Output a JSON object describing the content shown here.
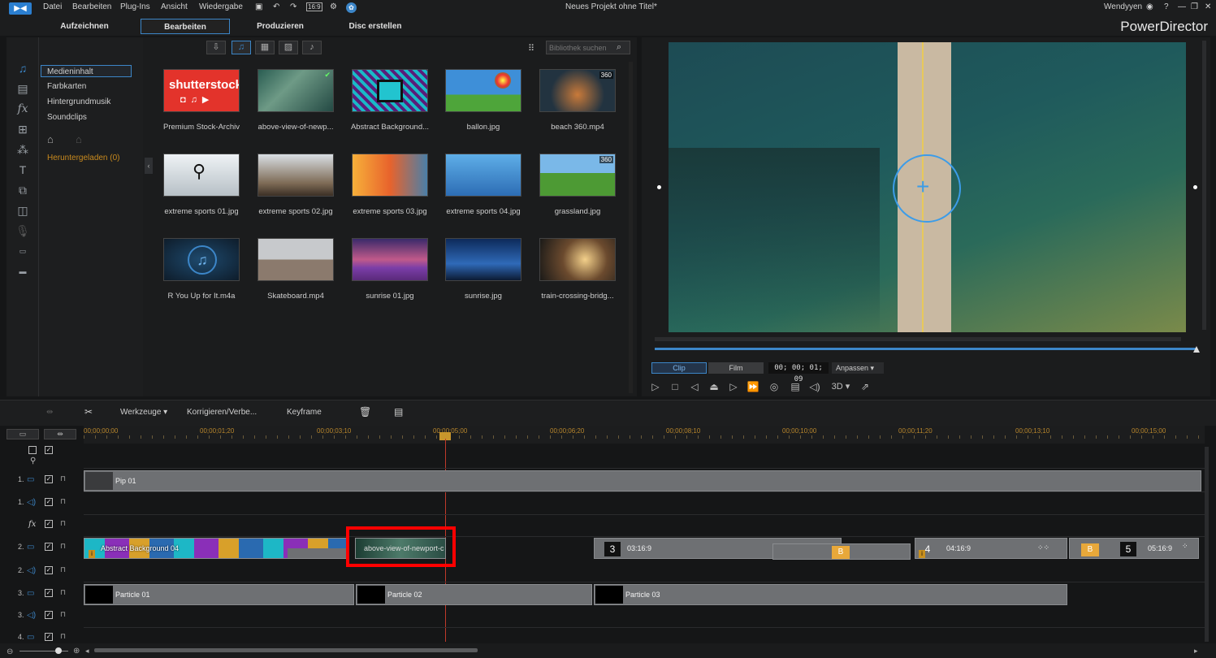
{
  "menu": {
    "items": [
      "Datei",
      "Bearbeiten",
      "Plug-Ins",
      "Ansicht",
      "Wiedergabe"
    ],
    "title": "Neues Projekt ohne Titel*",
    "user": "Wendyyen",
    "help": "?"
  },
  "tabs": [
    "Aufzeichnen",
    "Bearbeiten",
    "Produzieren",
    "Disc erstellen"
  ],
  "brand": "PowerDirector",
  "categories": [
    "Medieninhalt",
    "Farbkarten",
    "Hintergrundmusik",
    "Soundclips"
  ],
  "downloaded": "Heruntergeladen  (0)",
  "search": {
    "placeholder": "Bibliothek suchen"
  },
  "media": [
    {
      "label": "Premium Stock-Archiv",
      "logo": "shutterstock"
    },
    {
      "label": "above-view-of-newp..."
    },
    {
      "label": "Abstract Background..."
    },
    {
      "label": "ballon.jpg"
    },
    {
      "label": "beach 360.mp4",
      "badge": "360"
    },
    {
      "label": "extreme sports 01.jpg"
    },
    {
      "label": "extreme sports 02.jpg"
    },
    {
      "label": "extreme sports 03.jpg"
    },
    {
      "label": "extreme sports 04.jpg"
    },
    {
      "label": "grassland.jpg",
      "badge": "360"
    },
    {
      "label": "R You Up for It.m4a"
    },
    {
      "label": "Skateboard.mp4"
    },
    {
      "label": "sunrise 01.jpg"
    },
    {
      "label": "sunrise.jpg"
    },
    {
      "label": "train-crossing-bridg..."
    }
  ],
  "preview": {
    "mode_clip": "Clip",
    "mode_film": "Film",
    "timecode": "00; 00; 01; 09",
    "fit": "Anpassen",
    "three_d": "3D"
  },
  "timeline_tools": {
    "tools": "Werkzeuge",
    "fix": "Korrigieren/Verbe...",
    "keyframe": "Keyframe"
  },
  "ruler": [
    "00;00;00;00",
    "00;00;01;20",
    "00;00;03;10",
    "00;00;05;00",
    "00;00;06;20",
    "00;00;08;10",
    "00;00;10;00",
    "00;00;11;20",
    "00;00;13;10",
    "00;00;15;00"
  ],
  "tracks": {
    "n1": "1.",
    "n2": "2.",
    "n3": "3.",
    "n4": "4."
  },
  "clips": {
    "pip": "Pip 01",
    "abstract": "Abstract Background 04",
    "newport": "above-view-of-newport-c",
    "t3": "3",
    "t3time": "03:16:9",
    "t4": "4",
    "t4time": "04:16:9",
    "t5": "5",
    "t5time": "05:16:9",
    "particle1": "Particle 01",
    "particle2": "Particle 02",
    "particle3": "Particle 03"
  },
  "colors": {
    "accent": "#3c86c8",
    "highlight": "#ff0000",
    "playhead": "#c0392b"
  }
}
